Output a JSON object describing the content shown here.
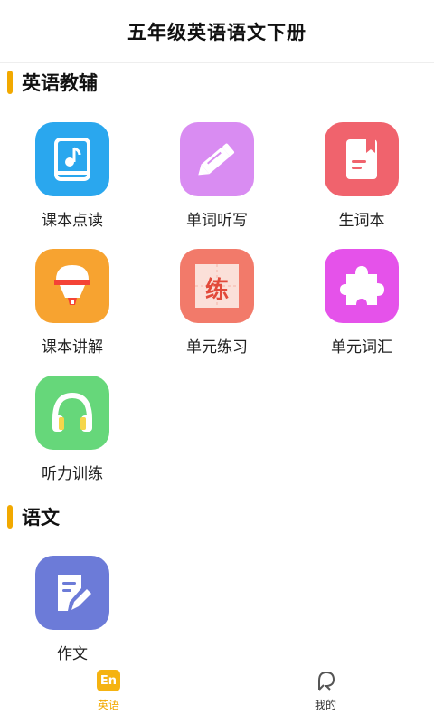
{
  "header": {
    "title": "五年级英语语文下册"
  },
  "sections": {
    "english": {
      "title": "英语教辅",
      "items": [
        {
          "label": "课本点读",
          "icon": "music-book-icon",
          "color": "#2aa7ee"
        },
        {
          "label": "单词听写",
          "icon": "pencil-icon",
          "color": "#d98cf2"
        },
        {
          "label": "生词本",
          "icon": "notebook-icon",
          "color": "#f0636d"
        },
        {
          "label": "课本讲解",
          "icon": "teacher-icon",
          "color": "#f7a330"
        },
        {
          "label": "单元练习",
          "icon": "practice-icon",
          "color": "#f27a6a",
          "glyph": "练"
        },
        {
          "label": "单元词汇",
          "icon": "puzzle-icon",
          "color": "#e552ea"
        },
        {
          "label": "听力训练",
          "icon": "headphones-icon",
          "color": "#66d77a"
        }
      ]
    },
    "chinese": {
      "title": "语文",
      "items": [
        {
          "label": "作文",
          "icon": "edit-document-icon",
          "color": "#6c7bd8"
        }
      ]
    }
  },
  "tabbar": {
    "active": "english",
    "tabs": [
      {
        "label": "英语",
        "icon_text": "En",
        "icon": "english-tab-icon",
        "color": "#f2a900"
      },
      {
        "label": "我的",
        "icon": "profile-icon",
        "color": "#333333"
      }
    ]
  }
}
